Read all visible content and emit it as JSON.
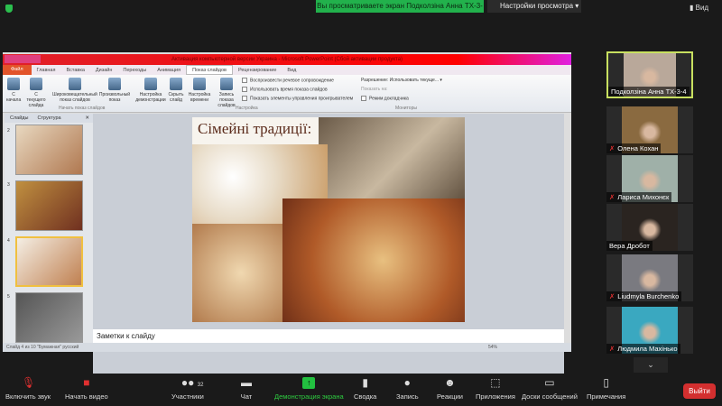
{
  "topbar": {
    "viewing": "Вы просматриваете экран Подколзіна Анна ТХ-3-4",
    "view_settings": "Настройки просмотра",
    "view": "Вид"
  },
  "ppt": {
    "title": "Активация компьютерной версии Украина - Microsoft PowerPoint (Сбой активации продукта)",
    "menu": [
      "Файл",
      "Главная",
      "Вставка",
      "Дизайн",
      "Переходы",
      "Анимация",
      "Показ слайдов",
      "Рецензирование",
      "Вид"
    ],
    "ribbon": {
      "from_start": "С начала",
      "from_current": "С текущего слайда",
      "broadcast": "Широковещательный показ слайдов",
      "custom": "Произвольный показ",
      "setup": "Настройка демонстрации",
      "hide": "Скрыть слайд",
      "timings": "Настройка времени",
      "record": "Запись показа слайдов",
      "checks": [
        "Воспроизвести речевое сопровождение",
        "Использовать время показа слайдов",
        "Показать элементы управления проигрывателем"
      ],
      "resolution": "Разрешение: Использовать текуще...",
      "show_on": "Показать на:",
      "presenter": "Режим докладчика",
      "groups": [
        "Начать показ слайдов",
        "Настройка",
        "Мониторы"
      ]
    },
    "pane_tabs": [
      "Слайды",
      "Структура"
    ],
    "thumb_numbers": [
      "2",
      "3",
      "4",
      "5"
    ],
    "slide_title": "Сімейні традиції:",
    "notes": "Заметки к слайду",
    "status": "Слайд 4 из 10   \"Бумажная\"   русский",
    "zoom": "54%"
  },
  "participants": [
    {
      "name": "Подколзіна Анна ТХ-3-4",
      "muted": false,
      "color": "#b9a89a"
    },
    {
      "name": "Олена Кохан",
      "muted": true,
      "color": "#8a6a40"
    },
    {
      "name": "Лариса Михонєк",
      "muted": true,
      "color": "#9fb0a8"
    },
    {
      "name": "Вера Дробот",
      "muted": false,
      "color": "#2a2420"
    },
    {
      "name": "Liudmyla Burchenko",
      "muted": true,
      "color": "#7a7a80"
    },
    {
      "name": "Людмила Махінько",
      "muted": true,
      "color": "#3aa8c0"
    }
  ],
  "toolbar": {
    "unmute": "Включить звук",
    "video": "Начать видео",
    "participants": "Участники",
    "participants_count": "32",
    "chat": "Чат",
    "share": "Демонстрация экрана",
    "summary": "Сводка",
    "record": "Запись",
    "reactions": "Реакции",
    "apps": "Приложения",
    "whiteboards": "Доски сообщений",
    "notes": "Примечания",
    "leave": "Выйти"
  }
}
